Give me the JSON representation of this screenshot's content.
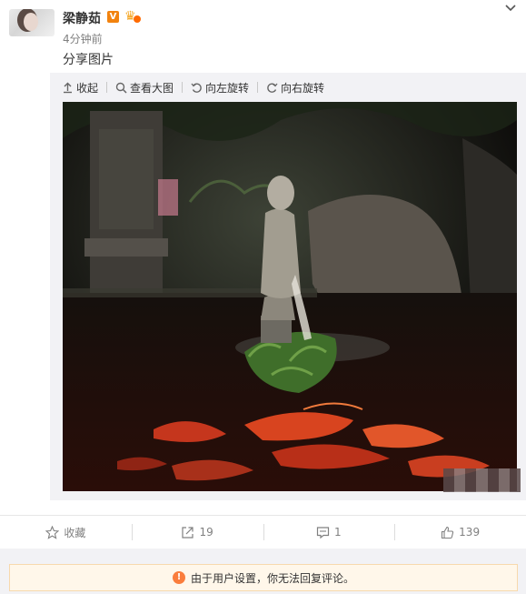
{
  "author": {
    "name": "梁静茹",
    "verified_mark": "V",
    "time": "4分钟前"
  },
  "post": {
    "text": "分享图片"
  },
  "media_toolbar": {
    "collapse": "收起",
    "view_large": "查看大图",
    "rotate_left": "向左旋转",
    "rotate_right": "向右旋转"
  },
  "actions": {
    "favorite": "收藏",
    "repost_count": "19",
    "comment_count": "1",
    "like_count": "139"
  },
  "notice": {
    "text": "由于用户设置，你无法回复评论。",
    "icon": "!"
  },
  "colors": {
    "accent_orange": "#fa7d3c",
    "verified_orange": "#f2830f",
    "muted_text": "#808080",
    "panel_bg": "#f2f2f5"
  }
}
